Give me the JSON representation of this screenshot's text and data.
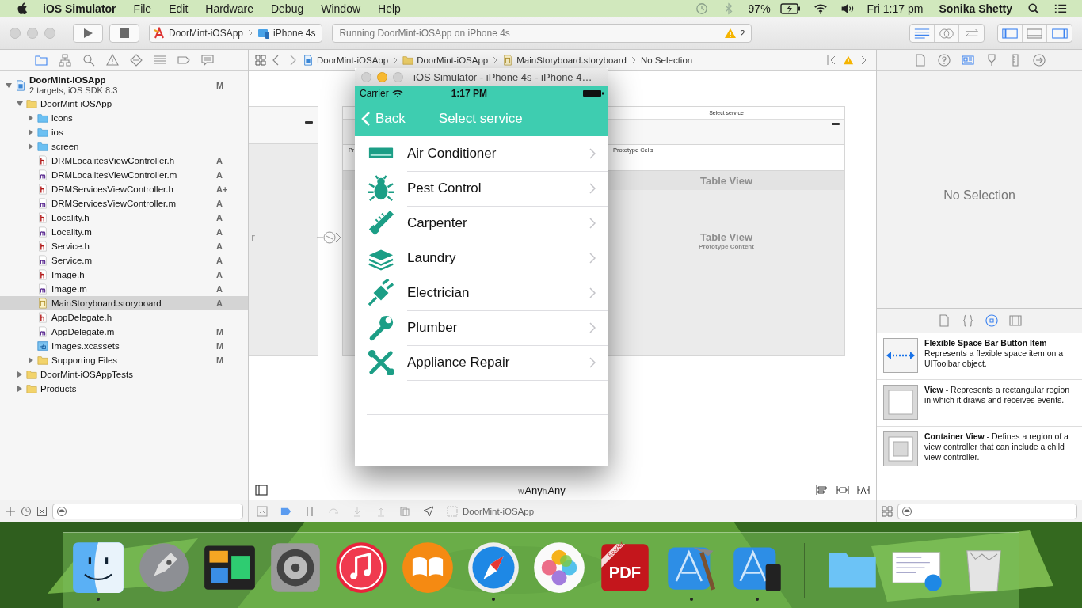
{
  "menu_bar": {
    "app": "iOS Simulator",
    "items": [
      "File",
      "Edit",
      "Hardware",
      "Debug",
      "Window",
      "Help"
    ],
    "battery": "97%",
    "clock": "Fri 1:17 pm",
    "user": "Sonika Shetty"
  },
  "toolbar": {
    "scheme": "DoorMint-iOSApp",
    "device": "iPhone 4s",
    "status": "Running DoorMint-iOSApp on iPhone 4s",
    "warnings": "2",
    "editor_modes": [
      {
        "kind": "standard",
        "selected": true
      },
      {
        "kind": "assistant",
        "selected": false
      },
      {
        "kind": "version",
        "selected": false
      }
    ],
    "panels": [
      {
        "kind": "navigator",
        "selected": true
      },
      {
        "kind": "debug",
        "selected": false
      },
      {
        "kind": "utilities",
        "selected": true
      }
    ]
  },
  "navigator": {
    "tabs": [
      {
        "kind": "folder",
        "selected": true
      },
      {
        "kind": "hierarchy",
        "selected": false
      },
      {
        "kind": "search",
        "selected": false
      },
      {
        "kind": "warning",
        "selected": false
      },
      {
        "kind": "diamond",
        "selected": false
      },
      {
        "kind": "list",
        "selected": false
      },
      {
        "kind": "tag",
        "selected": false
      },
      {
        "kind": "bubble",
        "selected": false
      }
    ],
    "tree": [
      {
        "kind": "project",
        "name": "DoorMint-iOSApp",
        "subtitle": "2 targets, iOS SDK 8.3",
        "status": "M",
        "expanded": true,
        "selected": false,
        "children": [
          {
            "kind": "group",
            "name": "DoorMint-iOSApp",
            "expanded": true,
            "selected": false,
            "children": [
              {
                "kind": "folder",
                "name": "icons",
                "expanded": false,
                "selected": false
              },
              {
                "kind": "folder",
                "name": "ios",
                "expanded": false,
                "selected": false
              },
              {
                "kind": "folder",
                "name": "screen",
                "expanded": false,
                "selected": false
              },
              {
                "kind": "header",
                "name": "DRMLocalitesViewController.h",
                "status": "A",
                "selected": false
              },
              {
                "kind": "source",
                "name": "DRMLocalitesViewController.m",
                "status": "A",
                "selected": false
              },
              {
                "kind": "header",
                "name": "DRMServicesViewController.h",
                "status": "A+",
                "selected": false
              },
              {
                "kind": "source",
                "name": "DRMServicesViewController.m",
                "status": "A",
                "selected": false
              },
              {
                "kind": "header",
                "name": "Locality.h",
                "status": "A",
                "selected": false
              },
              {
                "kind": "source",
                "name": "Locality.m",
                "status": "A",
                "selected": false
              },
              {
                "kind": "header",
                "name": "Service.h",
                "status": "A",
                "selected": false
              },
              {
                "kind": "source",
                "name": "Service.m",
                "status": "A",
                "selected": false
              },
              {
                "kind": "header",
                "name": "Image.h",
                "status": "A",
                "selected": false
              },
              {
                "kind": "source",
                "name": "Image.m",
                "status": "A",
                "selected": false
              },
              {
                "kind": "storyboard",
                "name": "MainStoryboard.storyboard",
                "status": "A",
                "selected": true
              },
              {
                "kind": "header",
                "name": "AppDelegate.h",
                "selected": false
              },
              {
                "kind": "source",
                "name": "AppDelegate.m",
                "status": "M",
                "selected": false
              },
              {
                "kind": "assets",
                "name": "Images.xcassets",
                "status": "M",
                "selected": false
              },
              {
                "kind": "group",
                "name": "Supporting Files",
                "status": "M",
                "expanded": false,
                "selected": false
              }
            ]
          },
          {
            "kind": "group",
            "name": "DoorMint-iOSAppTests",
            "expanded": false,
            "selected": false
          },
          {
            "kind": "group",
            "name": "Products",
            "expanded": false,
            "selected": false
          }
        ]
      }
    ]
  },
  "jump_bar": {
    "crumbs": [
      {
        "kind": "project",
        "label": "DoorMint-iOSApp"
      },
      {
        "kind": "group",
        "label": "DoorMint-iOSApp"
      },
      {
        "kind": "storyboard",
        "label": "MainStoryboard.storyboard"
      },
      {
        "kind": "none",
        "label": "No Selection"
      }
    ]
  },
  "canvas": {
    "left_scene_label": "r",
    "middle_scene_label": "Pr",
    "nav_title": "Select service",
    "prototype_cells": "Prototype Cells",
    "table_header": "Table View",
    "table_title": "Table View",
    "table_subtitle": "Prototype Content",
    "size_class": [
      {
        "prefix": "w",
        "value": "Any"
      },
      {
        "prefix": "h",
        "value": "Any"
      }
    ]
  },
  "editor_bottom": {
    "target": "DoorMint-iOSApp"
  },
  "inspector": {
    "tabs": [
      {
        "kind": "file",
        "selected": false
      },
      {
        "kind": "help",
        "selected": false
      },
      {
        "kind": "identity",
        "selected": true
      },
      {
        "kind": "attributes",
        "selected": false
      },
      {
        "kind": "size",
        "selected": false
      },
      {
        "kind": "connections",
        "selected": false
      }
    ],
    "empty": "No Selection"
  },
  "library": {
    "tabs": [
      {
        "kind": "file",
        "selected": false
      },
      {
        "kind": "braces",
        "selected": false
      },
      {
        "kind": "object",
        "selected": true
      },
      {
        "kind": "media",
        "selected": false
      }
    ],
    "items": [
      {
        "kind": "flexible-space",
        "text": "**Flexible Space Bar Button Item** - Represents a flexible space item on a UIToolbar object."
      },
      {
        "kind": "view",
        "text": "**View** - Represents a rectangular region in which it draws and receives events."
      },
      {
        "kind": "container",
        "text": "**Container View** - Defines a region of a view controller that can include a child view controller."
      }
    ]
  },
  "simulator": {
    "title": "iOS Simulator - iPhone 4s - iPhone 4…",
    "carrier": "Carrier",
    "time": "1:17 PM",
    "back": "Back",
    "nav_title": "Select service",
    "rows": [
      {
        "kind": "ac",
        "label": "Air Conditioner"
      },
      {
        "kind": "bug",
        "label": "Pest Control"
      },
      {
        "kind": "saw",
        "label": "Carpenter"
      },
      {
        "kind": "laundry",
        "label": "Laundry"
      },
      {
        "kind": "plug",
        "label": "Electrician"
      },
      {
        "kind": "wrench",
        "label": "Plumber"
      },
      {
        "kind": "tools",
        "label": "Appliance Repair"
      }
    ]
  },
  "dock": {
    "apps": [
      {
        "kind": "finder",
        "running": true
      },
      {
        "kind": "launchpad",
        "running": false
      },
      {
        "kind": "mission",
        "running": false
      },
      {
        "kind": "prefs",
        "running": false
      },
      {
        "kind": "music",
        "running": false
      },
      {
        "kind": "books",
        "running": false
      },
      {
        "kind": "safari",
        "running": true
      },
      {
        "kind": "photos",
        "running": false
      },
      {
        "kind": "pdf",
        "running": false,
        "label": "PDF",
        "ribbon": "Reader"
      },
      {
        "kind": "xcode",
        "running": true
      },
      {
        "kind": "simulator",
        "running": true
      }
    ],
    "stacks": [
      {
        "kind": "folder"
      },
      {
        "kind": "screenshot"
      },
      {
        "kind": "trash"
      }
    ]
  }
}
